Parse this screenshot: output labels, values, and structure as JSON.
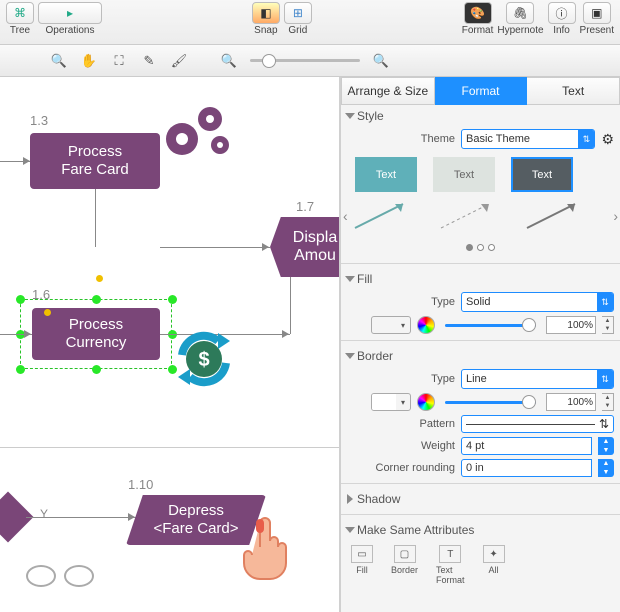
{
  "toolbar": {
    "tree": "Tree",
    "operations": "Operations",
    "snap": "Snap",
    "grid": "Grid",
    "format": "Format",
    "hypernote": "Hypernote",
    "info": "Info",
    "present": "Present"
  },
  "canvas": {
    "n13": "1.3",
    "n13_label": "Process\nFare Card",
    "n16": "1.6",
    "n16_label": "Process\nCurrency",
    "n17": "1.7",
    "n17_label": "Displa\nAmou",
    "n110": "1.10",
    "n110_label": "Depress\n<Fare Card>",
    "y_label": "Y"
  },
  "inspector": {
    "tab_arrange": "Arrange & Size",
    "tab_format": "Format",
    "tab_text": "Text",
    "sec_style": "Style",
    "theme_lbl": "Theme",
    "theme_val": "Basic Theme",
    "swatch_text": "Text",
    "sec_fill": "Fill",
    "type_lbl": "Type",
    "fill_type": "Solid",
    "pct100": "100%",
    "fill_color": "#7a4678",
    "sec_border": "Border",
    "border_type": "Line",
    "border_color": "#ffffff",
    "pattern_lbl": "Pattern",
    "weight_lbl": "Weight",
    "weight_val": "4 pt",
    "corner_lbl": "Corner rounding",
    "corner_val": "0 in",
    "sec_shadow": "Shadow",
    "sec_make_same": "Make Same Attributes",
    "ms_fill": "Fill",
    "ms_border": "Border",
    "ms_text": "Text\nFormat",
    "ms_all": "All"
  }
}
